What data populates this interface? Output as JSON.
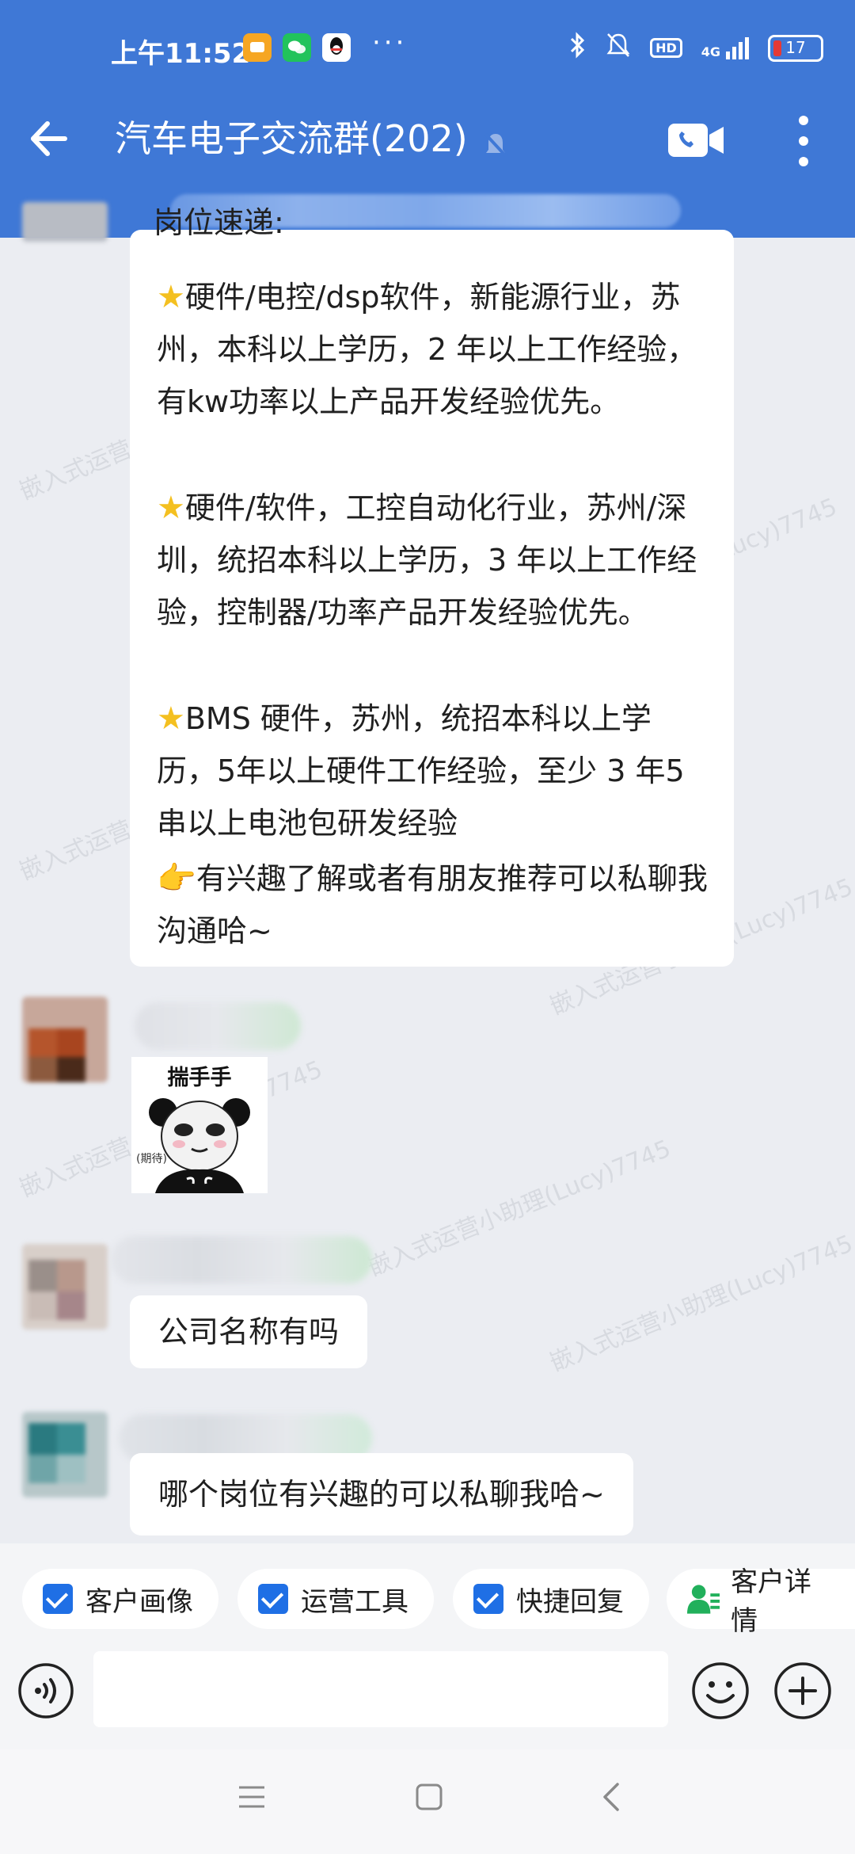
{
  "status_bar": {
    "time": "上午11:52",
    "dots": "···",
    "network": "4G",
    "hd": "HD",
    "battery_level": "17"
  },
  "header": {
    "title": "汽车电子交流群(202)"
  },
  "messages": {
    "truncated_line": "岗位速递:",
    "job_1": "硬件/电控/dsp软件，新能源行业，苏州，本科以上学历，2 年以上工作经验，有kw功率以上产品开发经验优先。",
    "job_2": "硬件/软件，工控自动化行业，苏州/深圳，统招本科以上学历，3 年以上工作经验，控制器/功率产品开发经验优先。",
    "job_3": "BMS 硬件，苏州，统招本科以上学历，5年以上硬件工作经验，至少 3 年5串以上电池包研发经验",
    "contact": "有兴趣了解或者有朋友推荐可以私聊我沟通哈~",
    "sticker_caption": "揣手手",
    "sticker_sub": "(期待)",
    "question": "公司名称有吗",
    "reply": "哪个岗位有兴趣的可以私聊我哈~"
  },
  "watermark": "嵌入式运营小助理(Lucy)7745",
  "tools": {
    "customer_profile": "客户画像",
    "ops_tools": "运营工具",
    "quick_reply": "快捷回复",
    "customer_detail": "客户详情"
  },
  "input": {
    "placeholder": ""
  },
  "colors": {
    "brand": "#3f78d6",
    "chip_check": "#1f6fe5",
    "bubble": "#ffffff"
  }
}
